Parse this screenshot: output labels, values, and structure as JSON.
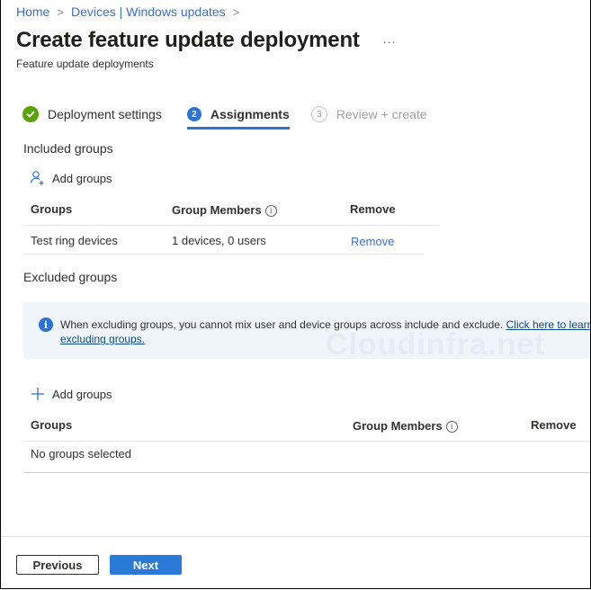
{
  "breadcrumb": [
    {
      "label": "Home"
    },
    {
      "label": "Devices | Windows updates"
    }
  ],
  "header": {
    "title": "Create feature update deployment",
    "more_label": "...",
    "subtitle": "Feature update deployments"
  },
  "steps": [
    {
      "label": "Deployment settings",
      "state": "completed",
      "badge": "✓"
    },
    {
      "label": "Assignments",
      "state": "active",
      "badge": "2"
    },
    {
      "label": "Review + create",
      "state": "upcoming",
      "badge": "3"
    }
  ],
  "included": {
    "label": "Included groups",
    "add_label": "Add groups",
    "columns": [
      "Groups",
      "Group Members",
      "Remove"
    ],
    "rows": [
      {
        "group": "Test ring devices",
        "members": "1 devices, 0 users",
        "action": "Remove"
      }
    ]
  },
  "excluded": {
    "label": "Excluded groups",
    "info_message": "When excluding groups, you cannot mix user and device groups across include and exclude.",
    "info_link": "Click here to learn more about excluding groups.",
    "info_link_visible_line1": "Click here to learn",
    "info_link_visible_line2": "excluding groups.",
    "watermark": "Cloudinfra.net",
    "add_label": "Add groups",
    "columns": [
      "Groups",
      "Group Members",
      "Remove"
    ],
    "empty_text": "No groups selected"
  },
  "footer": {
    "previous_label": "Previous",
    "next_label": "Next"
  },
  "colors": {
    "accent": "#2a74d5",
    "success": "#57a300",
    "link": "#3a6ed8",
    "info_bg": "#f0f5fc"
  }
}
